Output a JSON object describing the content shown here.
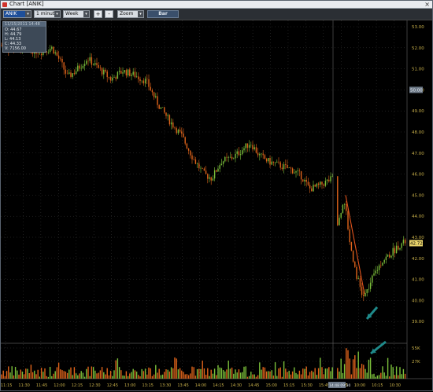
{
  "window": {
    "title": "Chart [ANIK]",
    "close": "×"
  },
  "toolbar": {
    "symbol": "ANIK",
    "interval": "1 minute",
    "range": "Week",
    "plus": "+",
    "minus": "-",
    "zoom": "Zoom",
    "bar": "Bar"
  },
  "infobox": {
    "header": "11/15/2011 14:48",
    "open": "O: 44.67",
    "high": "H: 44.79",
    "low": "L: 44.13",
    "close": "C: 44.33",
    "volume": "V: 7156.00"
  },
  "colors": {
    "up": "#7bbf3a",
    "down": "#e0641b",
    "grid": "#3a3a3a",
    "axis": "#c8b04a",
    "annotation": "#e2541d",
    "arrow": "#1f8a8a"
  },
  "price_axis": {
    "ticks": [
      "53.00",
      "52.00",
      "51.00",
      "50.00",
      "49.00",
      "48.00",
      "47.00",
      "46.00",
      "45.00",
      "44.00",
      "43.00",
      "42.00",
      "41.00",
      "40.00",
      "39.00"
    ],
    "current": "42.72",
    "marker": "50.00"
  },
  "volume_axis": {
    "ticks": [
      "55K",
      "27K"
    ]
  },
  "time_axis": {
    "ticks": [
      "11:15",
      "11:30",
      "11:45",
      "12:00",
      "12:15",
      "12:30",
      "12:45",
      "13:00",
      "13:15",
      "13:30",
      "13:45",
      "14:00",
      "14:15",
      "14:30",
      "14:45",
      "15:00",
      "15:15",
      "15:30",
      "15:45",
      "09:45",
      "10:00",
      "10:15",
      "10:30"
    ],
    "current": "14:48 09:30"
  },
  "chart_data": {
    "type": "candlestick",
    "ylim": [
      39,
      53
    ],
    "price_path": [
      [
        0,
        52.1
      ],
      [
        15,
        51.9
      ],
      [
        30,
        52.0
      ],
      [
        50,
        51.8
      ],
      [
        65,
        52.0
      ],
      [
        75,
        51.4
      ],
      [
        85,
        50.6
      ],
      [
        95,
        50.9
      ],
      [
        110,
        51.5
      ],
      [
        125,
        51.0
      ],
      [
        140,
        50.5
      ],
      [
        155,
        50.9
      ],
      [
        170,
        50.7
      ],
      [
        185,
        50.4
      ],
      [
        200,
        49.3
      ],
      [
        215,
        48.5
      ],
      [
        230,
        47.8
      ],
      [
        245,
        46.7
      ],
      [
        258,
        46.0
      ],
      [
        268,
        45.8
      ],
      [
        280,
        46.6
      ],
      [
        295,
        46.8
      ],
      [
        305,
        47.1
      ],
      [
        317,
        47.5
      ],
      [
        328,
        46.9
      ],
      [
        340,
        46.6
      ],
      [
        355,
        46.4
      ],
      [
        370,
        46.2
      ],
      [
        382,
        45.9
      ],
      [
        392,
        45.3
      ],
      [
        402,
        45.4
      ],
      [
        412,
        45.6
      ],
      [
        422,
        45.8
      ],
      [
        428,
        43.5
      ],
      [
        436,
        44.9
      ],
      [
        444,
        42.6
      ],
      [
        452,
        41.2
      ],
      [
        460,
        40.1
      ],
      [
        466,
        40.5
      ],
      [
        475,
        41.3
      ],
      [
        485,
        41.9
      ],
      [
        495,
        42.2
      ],
      [
        505,
        42.6
      ],
      [
        515,
        42.8
      ]
    ],
    "annotation_line": [
      [
        438,
        45.0
      ],
      [
        462,
        40.3
      ]
    ]
  }
}
